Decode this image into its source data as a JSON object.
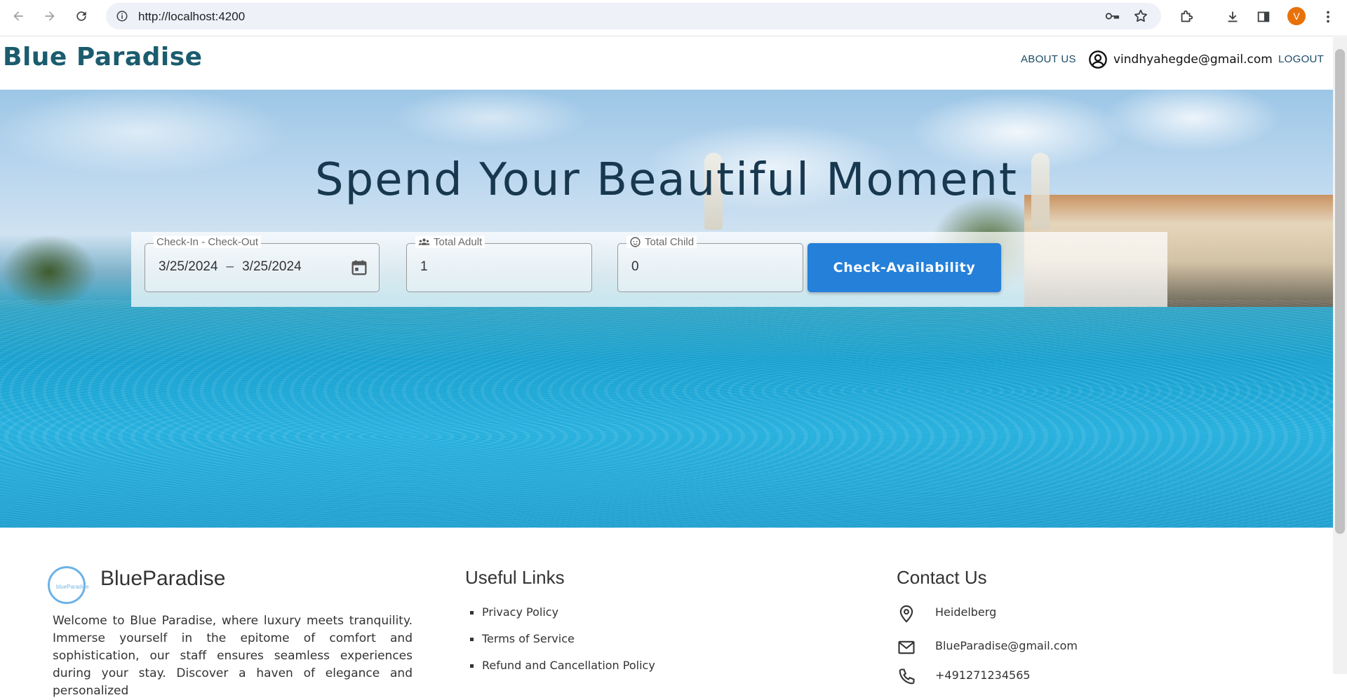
{
  "browser": {
    "url": "http://localhost:4200",
    "profile_initial": "V"
  },
  "header": {
    "brand": "Blue Paradise",
    "about_label": "ABOUT US",
    "user_email": "vindhyahegde@gmail.com",
    "logout_label": "LOGOUT"
  },
  "hero": {
    "title": "Spend Your Beautiful Moment",
    "checkin_label": "Check-In - Check-Out",
    "checkin_date": "3/25/2024",
    "date_separator": "–",
    "checkout_date": "3/25/2024",
    "adult_label": "Total Adult",
    "adult_value": "1",
    "child_label": "Total Child",
    "child_value": "0",
    "check_button": "Check-Availability"
  },
  "footer": {
    "brand": "BlueParadise",
    "logo_text": "blueParadise",
    "about_text": "Welcome to Blue Paradise, where luxury meets tranquility. Immerse yourself in the epitome of comfort and sophistication, our staff ensures seamless experiences during your stay. Discover a haven of elegance and personalized",
    "links_title": "Useful Links",
    "links": [
      "Privacy Policy",
      "Terms of Service",
      "Refund and Cancellation Policy"
    ],
    "contact_title": "Contact Us",
    "contact_location": "Heidelberg",
    "contact_email": "BlueParadise@gmail.com",
    "contact_phone": "+491271234565"
  },
  "colors": {
    "brand": "#1b5c6e",
    "button": "#2580d9",
    "hero_title": "#17384f"
  }
}
